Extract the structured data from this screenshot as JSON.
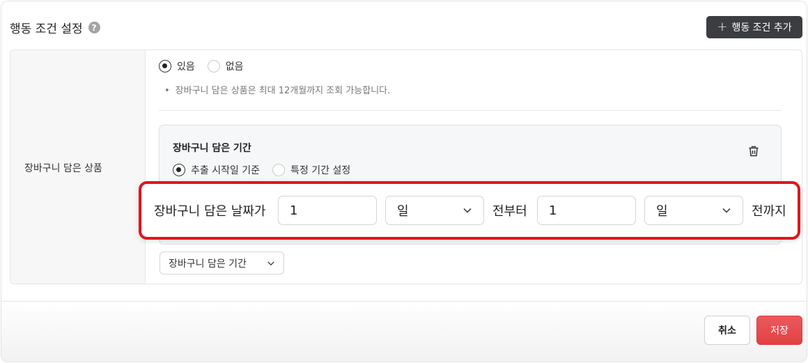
{
  "header": {
    "title": "행동 조건 설정",
    "help_glyph": "?",
    "add_button_plus": "+",
    "add_button_label": "행동 조건 추가"
  },
  "row": {
    "label": "장바구니 담은 상품",
    "presence_options": [
      {
        "label": "있음",
        "checked": true
      },
      {
        "label": "없음",
        "checked": false
      }
    ],
    "note_bullet": "•",
    "note": "장바구니 담은 상품은 최대 12개월까지 조회 가능합니다."
  },
  "period_card": {
    "title": "장바구니 담은 기간",
    "options": [
      {
        "label": "추출 시작일 기준",
        "checked": true
      },
      {
        "label": "특정 기간 설정",
        "checked": false
      }
    ]
  },
  "range": {
    "prefix": "장바구니 담은 날짜가",
    "from_value": "1",
    "from_unit": "일",
    "middle": "전부터",
    "to_value": "1",
    "to_unit": "일",
    "suffix": "전까지"
  },
  "condition_select": {
    "value": "장바구니 담은 기간"
  },
  "footer": {
    "cancel_label": "취소",
    "save_label": "저장"
  },
  "colors": {
    "dark_button": "#3b3d41",
    "highlight_border": "#e3141b",
    "save_button": "#e34043"
  },
  "icons": [
    "help-icon",
    "plus-icon",
    "trash-icon",
    "chevron-down-icon"
  ]
}
